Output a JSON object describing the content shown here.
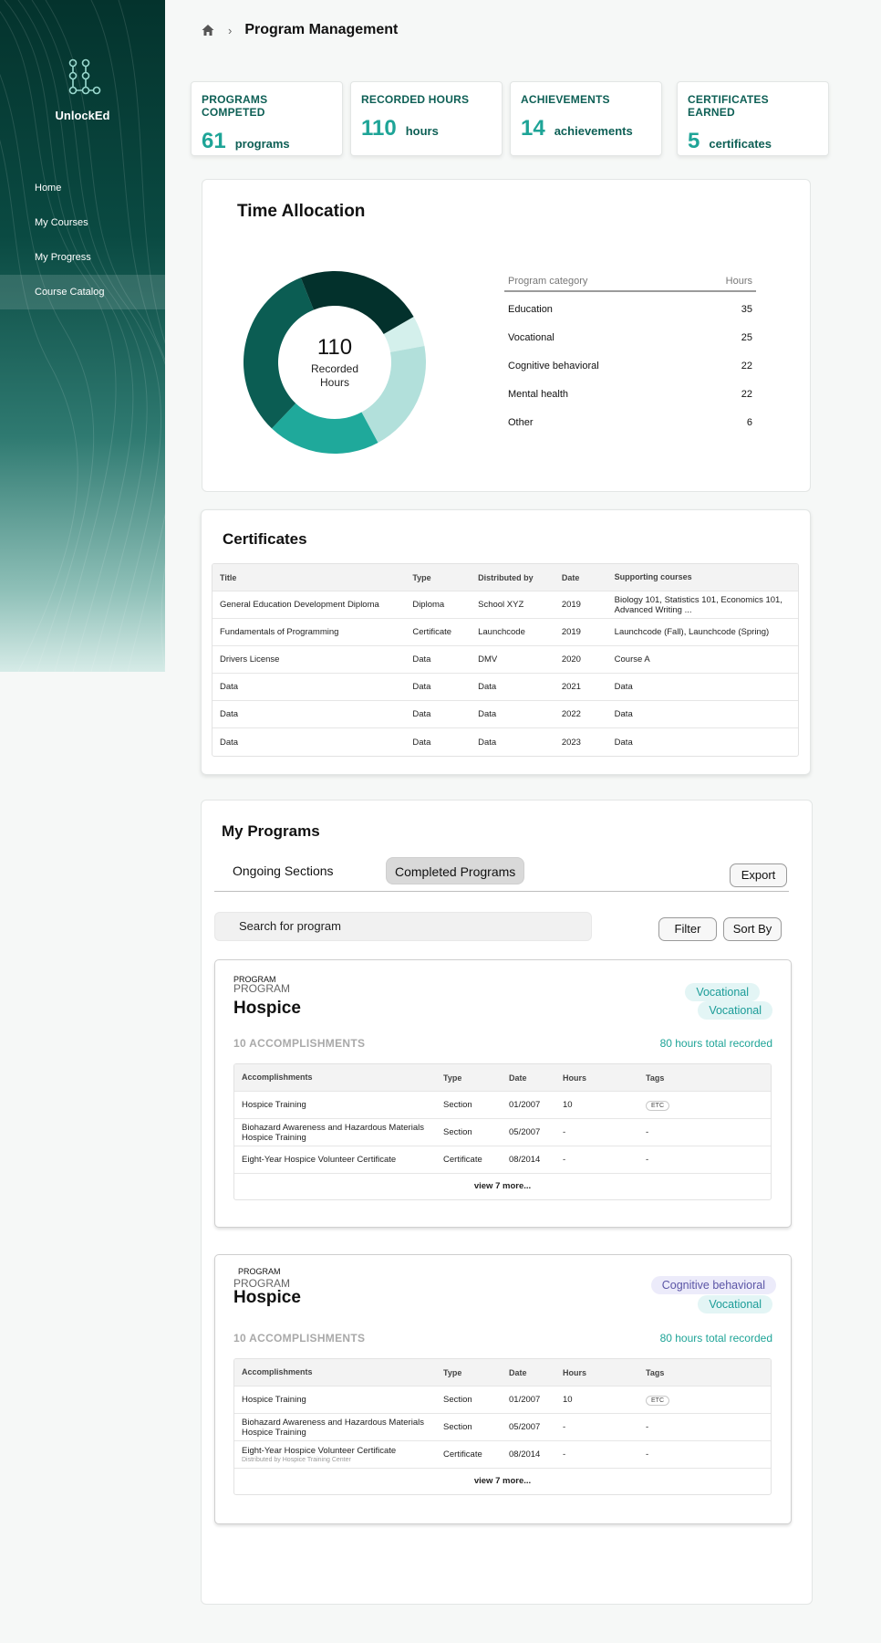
{
  "app": {
    "name": "UnlockEd"
  },
  "sidebar": {
    "items": [
      {
        "label": "Home"
      },
      {
        "label": "My Courses"
      },
      {
        "label": "My Progress"
      },
      {
        "label": "Course Catalog"
      }
    ]
  },
  "header": {
    "title": "Program Management"
  },
  "stats": [
    {
      "label": "PROGRAMS COMPETED",
      "value": "61",
      "unit": "programs"
    },
    {
      "label": "RECORDED HOURS",
      "value": "110",
      "unit": "hours"
    },
    {
      "label": "ACHIEVEMENTS",
      "value": "14",
      "unit": "achievements"
    },
    {
      "label": "CERTIFICATES EARNED",
      "value": "5",
      "unit": "certificates"
    }
  ],
  "time_allocation": {
    "title": "Time Allocation",
    "center_value": "110",
    "center_label": "Recorded Hours",
    "col_category": "Program category",
    "col_hours": "Hours",
    "rows": [
      {
        "category": "Education",
        "hours": "35"
      },
      {
        "category": "Vocational",
        "hours": "25"
      },
      {
        "category": "Cognitive behavioral",
        "hours": "22"
      },
      {
        "category": "Mental health",
        "hours": "22"
      },
      {
        "category": "Other",
        "hours": "6"
      }
    ]
  },
  "chart_data": {
    "type": "pie",
    "title": "",
    "categories": [
      "Other",
      "Mental health",
      "Cognitive behavioral",
      "Education",
      "Vocational"
    ],
    "values": [
      6,
      22,
      22,
      35,
      25
    ],
    "colors": [
      "#d4f0ec",
      "#b2e0db",
      "#1fa99b",
      "#0b5d53",
      "#03312c"
    ]
  },
  "certificates": {
    "title": "Certificates",
    "columns": [
      "Title",
      "Type",
      "Distributed by",
      "Date",
      "Supporting courses"
    ],
    "rows": [
      [
        "General Education Development Diploma",
        "Diploma",
        "School XYZ",
        "2019",
        "Biology 101, Statistics 101, Economics 101, Advanced Writing ..."
      ],
      [
        "Fundamentals of Programming",
        "Certificate",
        "Launchcode",
        "2019",
        "Launchcode (Fall), Launchcode (Spring)"
      ],
      [
        "Drivers License",
        "Data",
        "DMV",
        "2020",
        "Course A"
      ],
      [
        "Data",
        "Data",
        "Data",
        "2021",
        "Data"
      ],
      [
        "Data",
        "Data",
        "Data",
        "2022",
        "Data"
      ],
      [
        "Data",
        "Data",
        "Data",
        "2023",
        "Data"
      ]
    ]
  },
  "programs": {
    "title": "My Programs",
    "tab_ongoing": "Ongoing Sections",
    "tab_completed": "Completed Programs",
    "export_label": "Export",
    "search_placeholder": "Search for program",
    "filter_label": "Filter",
    "sort_label": "Sort By",
    "cards": [
      {
        "kicker_small": "PROGRAM",
        "kicker": "PROGRAM",
        "name": "Hospice",
        "tags": [
          "Vocational",
          "Vocational"
        ],
        "accomplishments": "10 ACCOMPLISHMENTS",
        "hours_total": "80 hours total recorded",
        "columns": [
          "Accomplishments",
          "Type",
          "Date",
          "Hours",
          "Tags"
        ],
        "rows": [
          {
            "title": "Hospice Training",
            "sub": "",
            "type": "Section",
            "date": "01/2007",
            "hours": "10",
            "tag": "ETC"
          },
          {
            "title": "Biohazard Awareness and Hazardous Materials Hospice Training",
            "sub": "",
            "type": "Section",
            "date": "05/2007",
            "hours": "-",
            "tag": "-"
          },
          {
            "title": "Eight-Year Hospice Volunteer Certificate",
            "sub": "",
            "type": "Certificate",
            "date": "08/2014",
            "hours": "-",
            "tag": "-"
          }
        ],
        "view_more": "view 7 more..."
      },
      {
        "kicker_small": "PROGRAM",
        "kicker": "PROGRAM",
        "name": "Hospice",
        "tags": [
          "Cognitive behavioral",
          "Vocational"
        ],
        "accomplishments": "10 ACCOMPLISHMENTS",
        "hours_total": "80 hours total recorded",
        "columns": [
          "Accomplishments",
          "Type",
          "Date",
          "Hours",
          "Tags"
        ],
        "rows": [
          {
            "title": "Hospice Training",
            "sub": "",
            "type": "Section",
            "date": "01/2007",
            "hours": "10",
            "tag": "ETC"
          },
          {
            "title": "Biohazard Awareness and Hazardous Materials Hospice Training",
            "sub": "",
            "type": "Section",
            "date": "05/2007",
            "hours": "-",
            "tag": "-"
          },
          {
            "title": "Eight-Year Hospice Volunteer Certificate",
            "sub": "Distributed by Hospice Training Center",
            "type": "Certificate",
            "date": "08/2014",
            "hours": "-",
            "tag": "-"
          }
        ],
        "view_more": "view 7 more..."
      }
    ]
  }
}
